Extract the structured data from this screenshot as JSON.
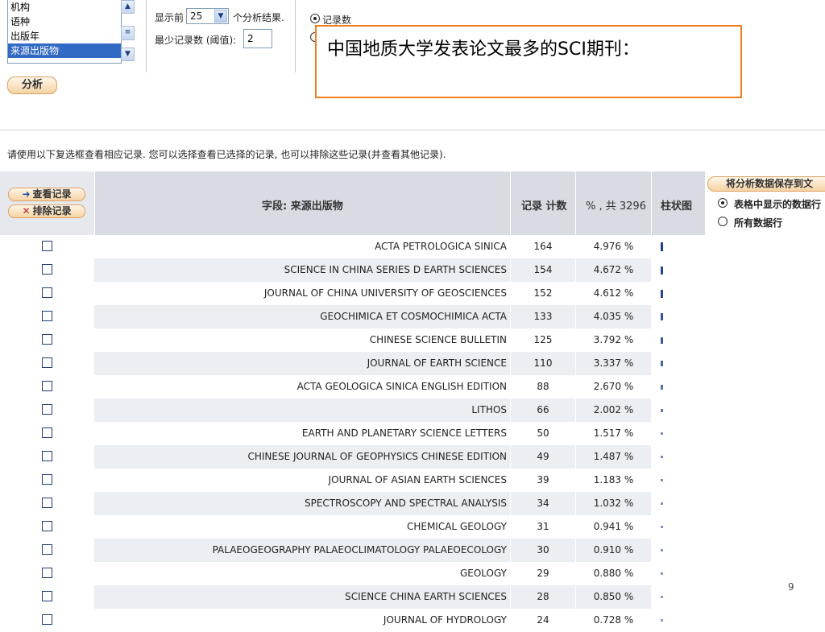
{
  "field_list": {
    "items": [
      "机构",
      "语种",
      "出版年",
      "来源出版物"
    ],
    "selected_index": 3
  },
  "display": {
    "prefix": "显示前",
    "select_value": "25",
    "suffix": "个分析结果."
  },
  "threshold": {
    "label": "最少记录数 (阈值):",
    "value": "2"
  },
  "sort": {
    "option_1": "记录数",
    "selected": "记录数"
  },
  "analyze_button": "分析",
  "callout": {
    "text": "中国地质大学发表论文最多的SCI期刊："
  },
  "instructions": "请使用以下复选框查看相应记录. 您可以选择查看已选择的记录, 也可以排除这些记录(并查看其他记录).",
  "table": {
    "view_records_button": "查看记录",
    "exclude_records_button": "排除记录",
    "field_header": "字段: 来源出版物",
    "count_header": "记录 计数",
    "percent_header": "% , 共 3296",
    "chart_header": "柱状图",
    "rows": [
      {
        "name": "ACTA PETROLOGICA SINICA",
        "count": "164",
        "percent": "4.976 %",
        "fraction": 0.04976
      },
      {
        "name": "SCIENCE IN CHINA SERIES D EARTH SCIENCES",
        "count": "154",
        "percent": "4.672 %",
        "fraction": 0.04672
      },
      {
        "name": "JOURNAL OF CHINA UNIVERSITY OF GEOSCIENCES",
        "count": "152",
        "percent": "4.612 %",
        "fraction": 0.04612
      },
      {
        "name": "GEOCHIMICA ET COSMOCHIMICA ACTA",
        "count": "133",
        "percent": "4.035 %",
        "fraction": 0.04035
      },
      {
        "name": "CHINESE SCIENCE BULLETIN",
        "count": "125",
        "percent": "3.792 %",
        "fraction": 0.03792
      },
      {
        "name": "JOURNAL OF EARTH SCIENCE",
        "count": "110",
        "percent": "3.337 %",
        "fraction": 0.03337
      },
      {
        "name": "ACTA GEOLOGICA SINICA ENGLISH EDITION",
        "count": "88",
        "percent": "2.670 %",
        "fraction": 0.0267
      },
      {
        "name": "LITHOS",
        "count": "66",
        "percent": "2.002 %",
        "fraction": 0.02002
      },
      {
        "name": "EARTH AND PLANETARY SCIENCE LETTERS",
        "count": "50",
        "percent": "1.517 %",
        "fraction": 0.01517
      },
      {
        "name": "CHINESE JOURNAL OF GEOPHYSICS CHINESE EDITION",
        "count": "49",
        "percent": "1.487 %",
        "fraction": 0.01487
      },
      {
        "name": "JOURNAL OF ASIAN EARTH SCIENCES",
        "count": "39",
        "percent": "1.183 %",
        "fraction": 0.01183
      },
      {
        "name": "SPECTROSCOPY AND SPECTRAL ANALYSIS",
        "count": "34",
        "percent": "1.032 %",
        "fraction": 0.01032
      },
      {
        "name": "CHEMICAL GEOLOGY",
        "count": "31",
        "percent": "0.941 %",
        "fraction": 0.00941
      },
      {
        "name": "PALAEOGEOGRAPHY PALAEOCLIMATOLOGY PALAEOECOLOGY",
        "count": "30",
        "percent": "0.910 %",
        "fraction": 0.0091
      },
      {
        "name": "GEOLOGY",
        "count": "29",
        "percent": "0.880 %",
        "fraction": 0.0088
      },
      {
        "name": "SCIENCE CHINA EARTH SCIENCES",
        "count": "28",
        "percent": "0.850 %",
        "fraction": 0.0085
      },
      {
        "name": "JOURNAL OF HYDROLOGY",
        "count": "24",
        "percent": "0.728 %",
        "fraction": 0.00728
      }
    ]
  },
  "save_panel": {
    "button": "将分析数据保存到文",
    "option_1": "表格中显示的数据行",
    "option_2": "所有数据行",
    "selected": "表格中显示的数据行"
  },
  "page_number": "9",
  "colors": {
    "callout_border": "#ee7d1a",
    "header_bg": "#d8dbe2",
    "row_alt_bg": "#ebeef3",
    "bar_color": "#1d3f8f",
    "selected_item_bg": "#316ac5"
  }
}
